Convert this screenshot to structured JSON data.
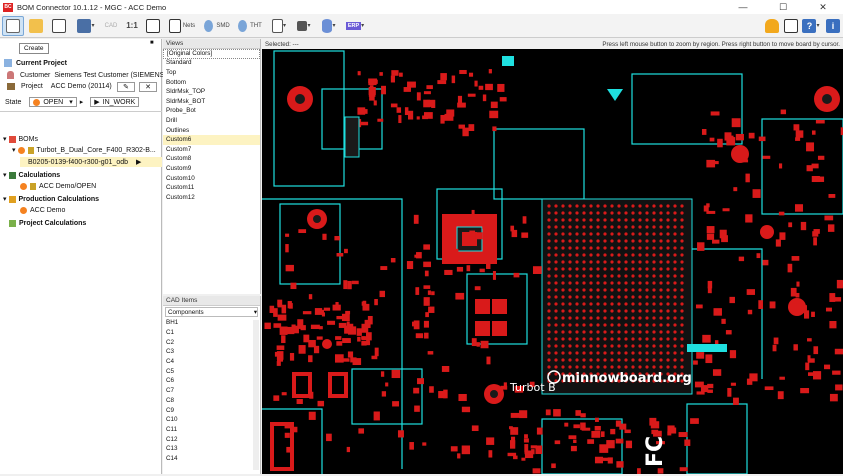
{
  "window": {
    "title": "BOM Connector 10.1.12 - MGC - ACC Demo"
  },
  "toolbar": {
    "cad": "CAD",
    "ratio": "1:1",
    "nets": "Nets",
    "smd": "SMD",
    "tht": "THT",
    "erp": "ERP",
    "create_tooltip": "Create"
  },
  "left": {
    "current_project": "Current Project",
    "customer_label": "Customer",
    "customer_value": "Siemens Test Customer (SIEMENS1)",
    "project_label": "Project",
    "project_value": "ACC Demo (20114)",
    "state_label": "State",
    "state_value": "OPEN",
    "state_next": "IN_WORK",
    "tree": {
      "boms": "BOMs",
      "bom_item": "Turbot_B_Dual_Core_F400_R302-B...",
      "bom_sub": "B0205-0139-f400-r300-g01_odb",
      "calculations": "Calculations",
      "calc_item": "ACC Demo/OPEN",
      "production": "Production Calculations",
      "prod_item": "ACC Demo",
      "project_calcs": "Project Calculations"
    }
  },
  "views": {
    "header": "Views",
    "items": [
      "[Original Colors]",
      "Standard",
      "Top",
      "Bottom",
      "SldrMsk_TOP",
      "SldrMsk_BOT",
      "Probe_Bot",
      "Drill",
      "Outlines",
      "Custom6",
      "Custom7",
      "Custom8",
      "Custom9",
      "Custom10",
      "Custom11",
      "Custom12"
    ]
  },
  "cad": {
    "header": "CAD Items",
    "select": "Components",
    "items": [
      "BH1",
      "C1",
      "C2",
      "C3",
      "C4",
      "C5",
      "C6",
      "C7",
      "C8",
      "C9",
      "C10",
      "C11",
      "C12",
      "C13",
      "C14"
    ]
  },
  "status": {
    "selected": "Selected: ---",
    "hint": "Press left mouse button to zoom by region. Press right button to move board by cursor."
  },
  "board": {
    "logo": "minnowboard.org",
    "sublogo": "Turbot B"
  }
}
